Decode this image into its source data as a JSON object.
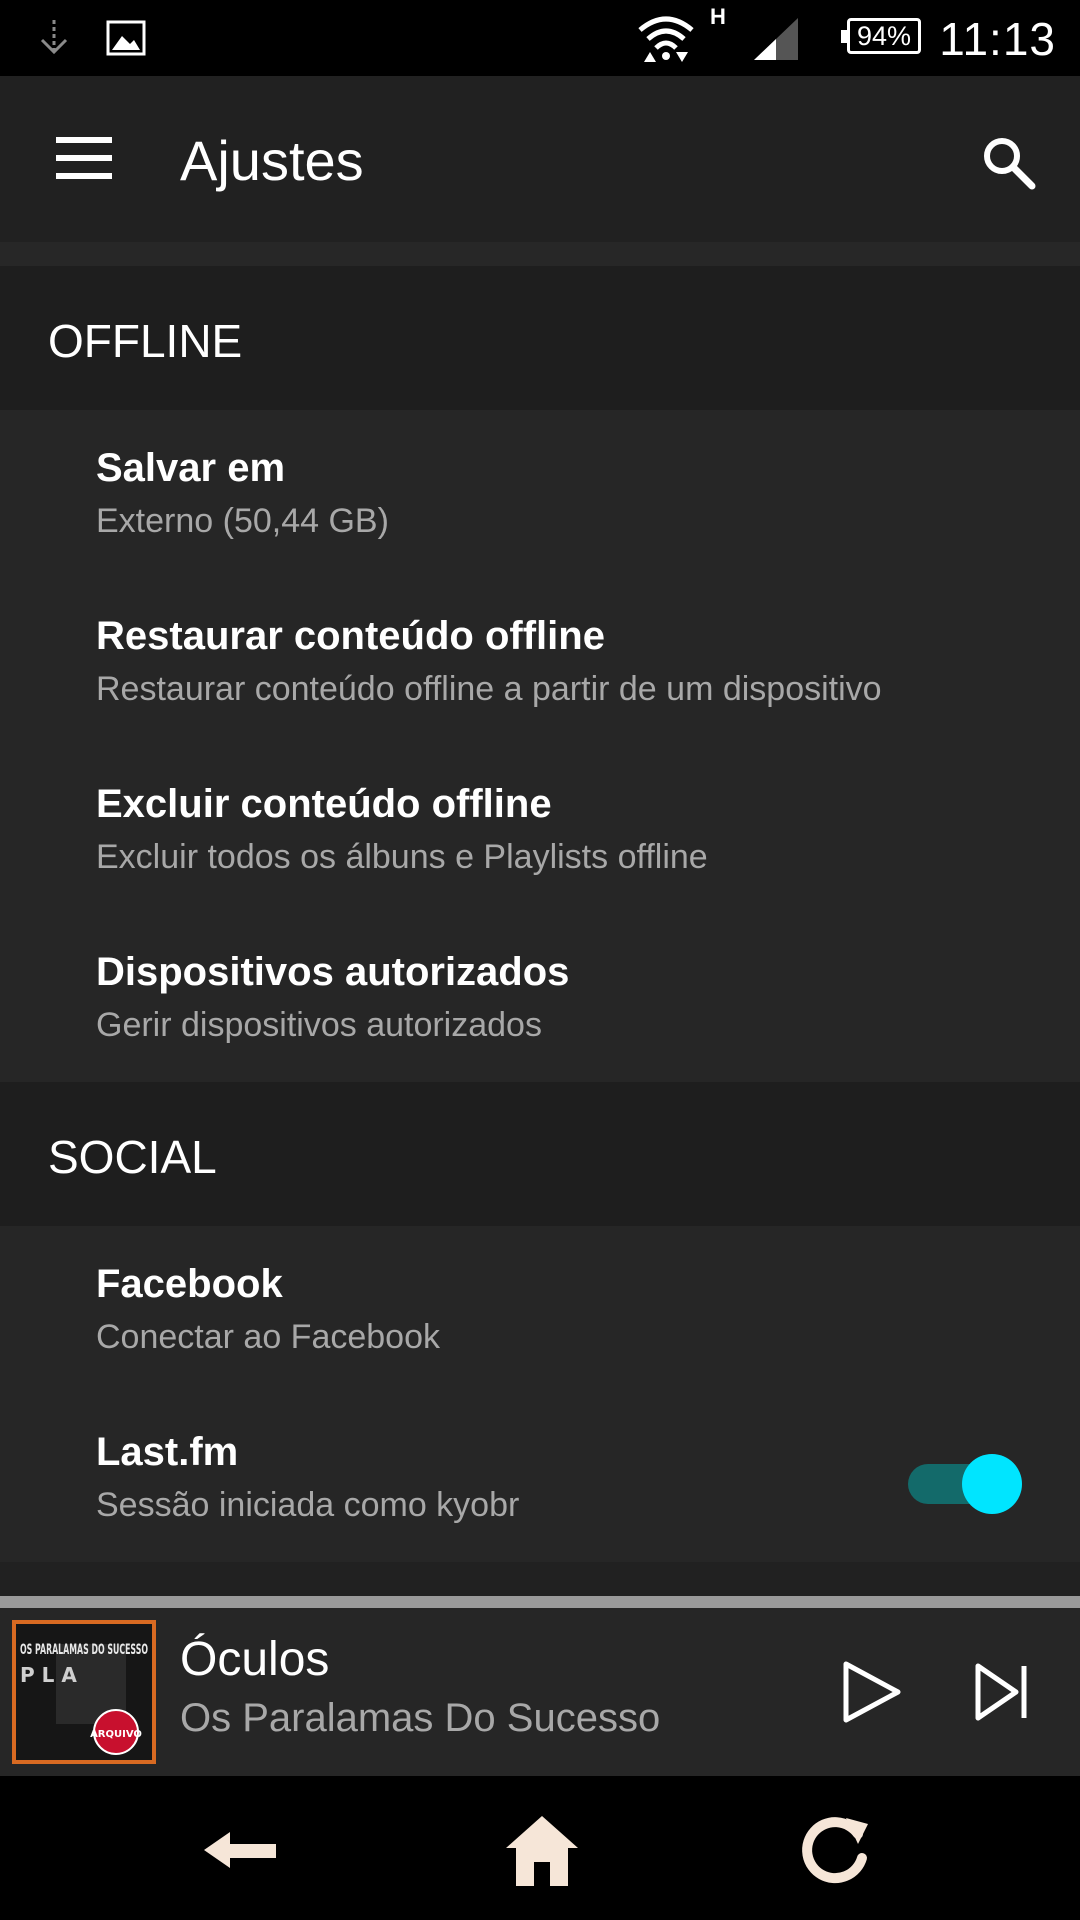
{
  "status_bar": {
    "clock": "11:13",
    "battery": "94%",
    "network_type": "H",
    "icons": [
      "download-icon",
      "image-icon",
      "wifi-icon",
      "signal-icon",
      "battery-icon"
    ]
  },
  "toolbar": {
    "title": "Ajustes",
    "menu_icon": "menu-icon",
    "search_icon": "search-icon"
  },
  "sections": {
    "offline": {
      "header": "OFFLINE",
      "items": [
        {
          "title": "Salvar em",
          "subtitle": "Externo (50,44 GB)"
        },
        {
          "title": "Restaurar conteúdo offline",
          "subtitle": "Restaurar conteúdo offline a partir de um dispositivo"
        },
        {
          "title": "Excluir conteúdo offline",
          "subtitle": "Excluir todos os álbuns e Playlists offline"
        },
        {
          "title": "Dispositivos autorizados",
          "subtitle": "Gerir dispositivos autorizados"
        }
      ]
    },
    "social": {
      "header": "SOCIAL",
      "items": [
        {
          "title": "Facebook",
          "subtitle": "Conectar ao Facebook"
        },
        {
          "title": "Last.fm",
          "subtitle": "Sessão iniciada como kyobr",
          "toggle": true
        }
      ]
    }
  },
  "player": {
    "track": "Óculos",
    "artist": "Os Paralamas Do Sucesso",
    "album_art": {
      "title_text": "OS PARALAMAS DO SUCESSO",
      "badge": "ARQUIVO"
    }
  },
  "nav_bar": {
    "icons": [
      "back-icon",
      "home-icon",
      "recent-apps-icon"
    ]
  },
  "colors": {
    "accent": "#00e5ff",
    "toggle_track": "#136a6a",
    "album_border": "#d86a22",
    "background": "#212121"
  }
}
